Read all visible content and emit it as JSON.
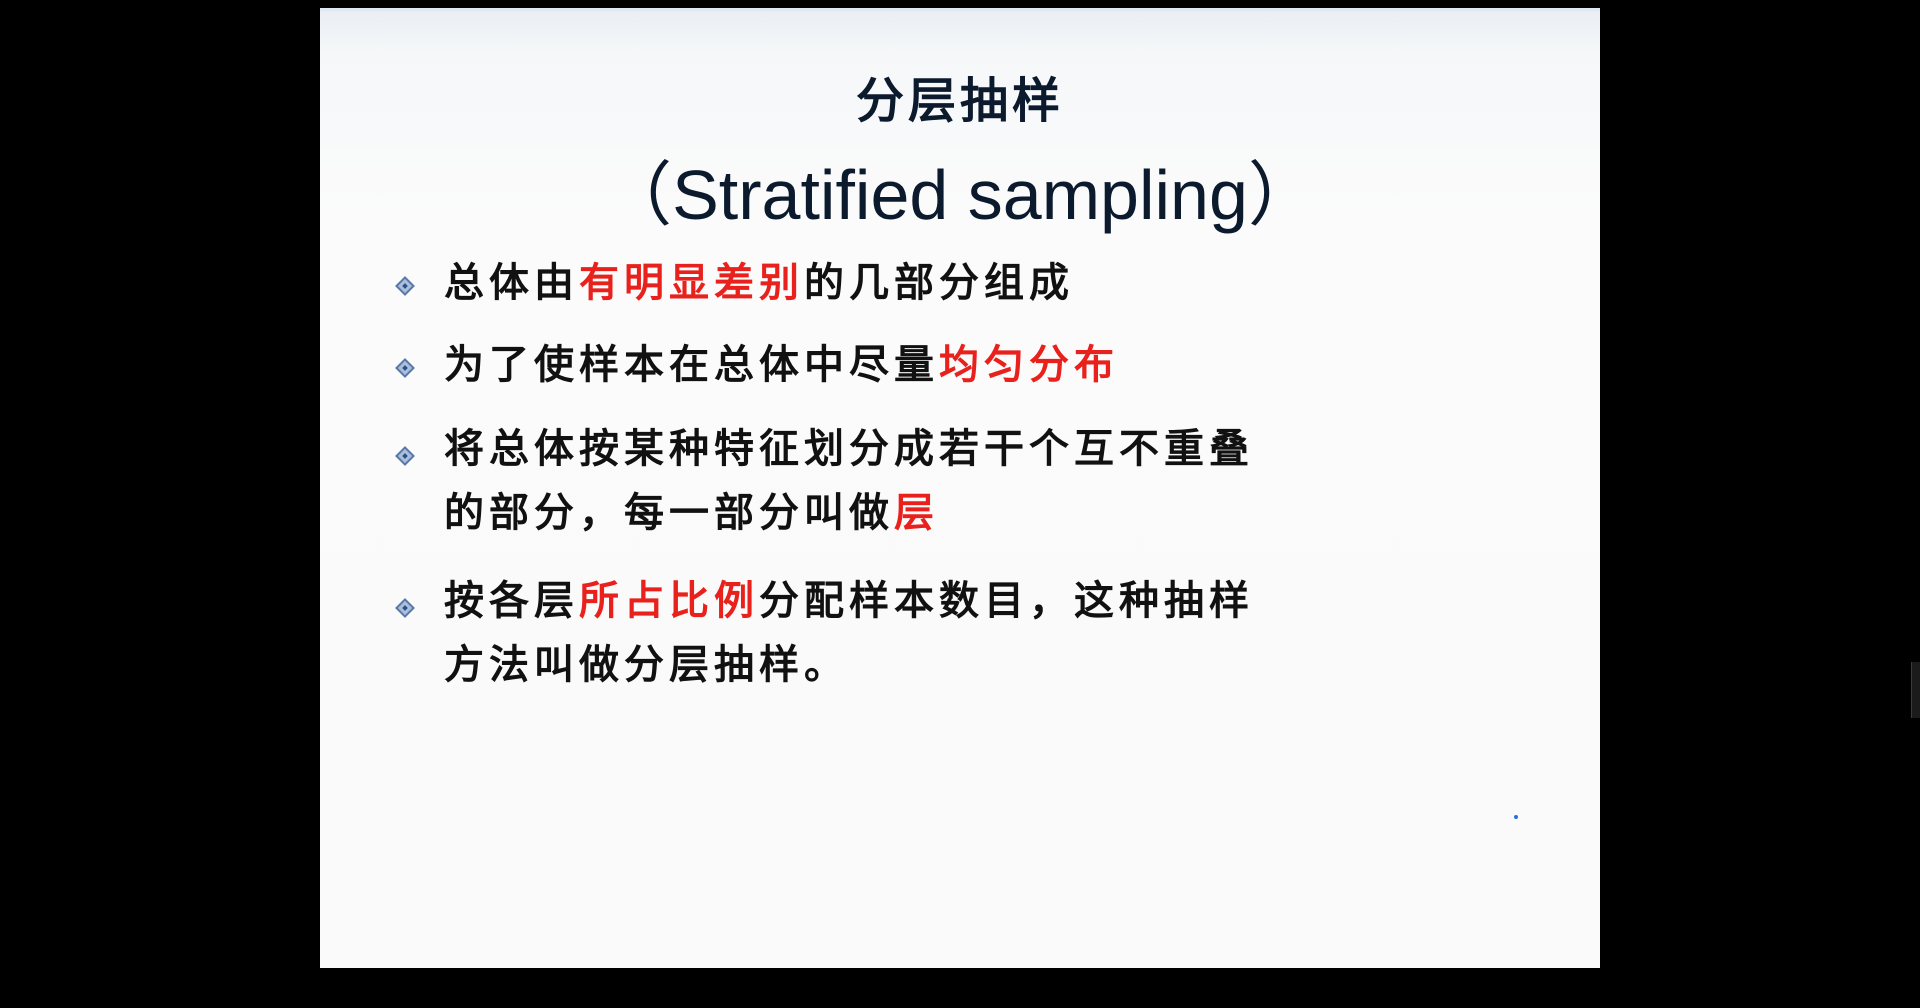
{
  "slide": {
    "title_cn": "分层抽样",
    "title_en": "（Stratified sampling）",
    "colors": {
      "title": "#0c1a2e",
      "text": "#111111",
      "highlight": "#e8211c",
      "bullet": "#5a78a8"
    },
    "bullets": [
      {
        "icon": "diamond-bullet-icon",
        "line1": {
          "a": "总体由",
          "b": "有明显差别",
          "c": "的几部分组成"
        }
      },
      {
        "icon": "diamond-bullet-icon",
        "line1": {
          "a": "为了使样本在总体中尽量",
          "b": "均匀分布"
        }
      },
      {
        "icon": "diamond-bullet-icon",
        "line1": {
          "a": "将总体按某种特征划分成若干个互不重叠"
        },
        "line2": {
          "a": "的部分，每一部分叫做",
          "b": "层"
        }
      },
      {
        "icon": "diamond-bullet-icon",
        "line1": {
          "a": "按各层",
          "b": "所占比例",
          "c": "分配样本数目，这种抽样"
        },
        "line2": {
          "a": "方法叫做分层抽样。"
        }
      }
    ]
  }
}
